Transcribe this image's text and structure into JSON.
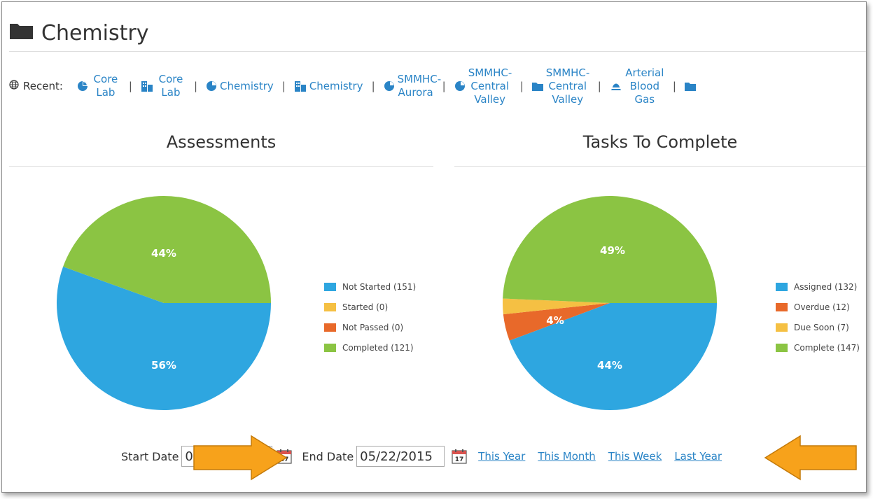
{
  "page": {
    "title": "Chemistry"
  },
  "recent": {
    "label": "Recent:",
    "items": [
      {
        "icon": "pie-chart-icon",
        "lines": [
          "Core",
          "Lab"
        ]
      },
      {
        "icon": "building-icon",
        "lines": [
          "Core",
          "Lab"
        ]
      },
      {
        "icon": "pie-chart-icon",
        "lines": [
          "Chemistry"
        ]
      },
      {
        "icon": "building-icon",
        "lines": [
          "Chemistry"
        ]
      },
      {
        "icon": "pie-chart-icon",
        "lines": [
          "SMMHC-",
          "Aurora"
        ]
      },
      {
        "icon": "pie-chart-icon",
        "lines": [
          "SMMHC-",
          "Central",
          "Valley"
        ]
      },
      {
        "icon": "folder-icon",
        "lines": [
          "SMMHC-",
          "Central",
          "Valley"
        ]
      },
      {
        "icon": "flask-icon",
        "lines": [
          "Arterial",
          "Blood",
          "Gas"
        ]
      },
      {
        "icon": "folder-icon",
        "lines": []
      }
    ]
  },
  "assessments": {
    "title": "Assessments",
    "legend": [
      "Not Started (151)",
      "Started (0)",
      "Not Passed (0)",
      "Completed (121)"
    ]
  },
  "tasks": {
    "title": "Tasks To Complete",
    "legend": [
      "Assigned (132)",
      "Overdue (12)",
      "Due Soon (7)",
      "Complete (147)"
    ]
  },
  "chart_data": [
    {
      "type": "pie",
      "title": "Assessments",
      "categories": [
        "Not Started",
        "Started",
        "Not Passed",
        "Completed"
      ],
      "values": [
        151,
        0,
        0,
        121
      ],
      "labels": [
        "56%",
        "",
        "",
        "44%"
      ],
      "colors": [
        "#2ea6e0",
        "#f5c043",
        "#e8692a",
        "#8bc443"
      ],
      "legend_position": "right"
    },
    {
      "type": "pie",
      "title": "Tasks To Complete",
      "categories": [
        "Assigned",
        "Overdue",
        "Due Soon",
        "Complete"
      ],
      "values": [
        132,
        12,
        7,
        147
      ],
      "labels": [
        "44%",
        "4%",
        "",
        "49%"
      ],
      "colors": [
        "#2ea6e0",
        "#e8692a",
        "#f5c043",
        "#8bc443"
      ],
      "legend_position": "right"
    }
  ],
  "dates": {
    "start_label": "Start Date",
    "start_value": "0",
    "end_label": "End Date",
    "end_value": "05/22/2015",
    "calendar_day": "17",
    "links": [
      "This Year",
      "This Month",
      "This Week",
      "Last Year"
    ]
  },
  "annotation_color": "#f7a21b"
}
